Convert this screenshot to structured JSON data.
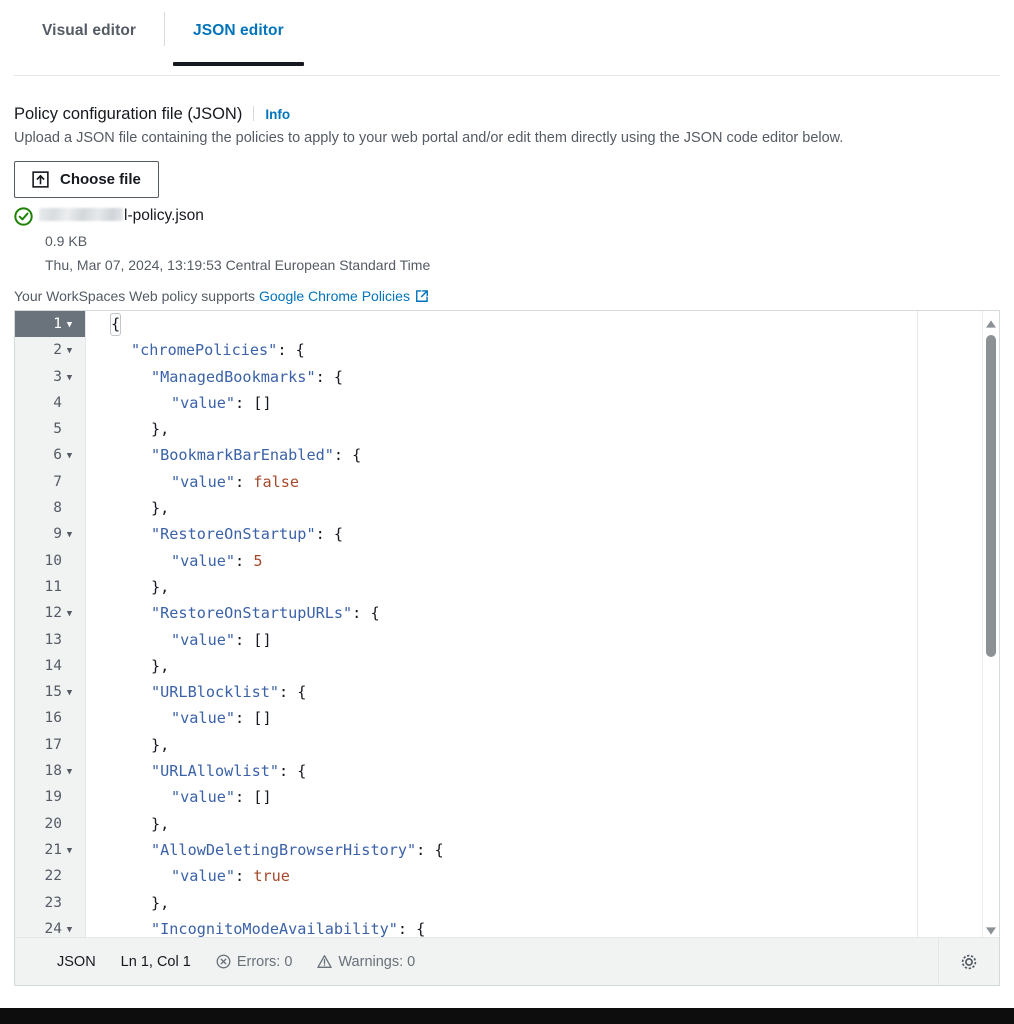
{
  "tabs": [
    {
      "label": "Visual editor",
      "active": false
    },
    {
      "label": "JSON editor",
      "active": true
    }
  ],
  "field": {
    "title": "Policy configuration file (JSON)",
    "info_label": "Info",
    "description": "Upload a JSON file containing the policies to apply to your web portal and/or edit them directly using the JSON code editor below.",
    "choose_file_label": "Choose file",
    "upload_icon": "upload-icon"
  },
  "uploaded_file": {
    "status_icon": "success-check-icon",
    "name_redacted": true,
    "name_suffix": "l-policy.json",
    "size": "0.9 KB",
    "timestamp": "Thu, Mar 07, 2024, 13:19:53 Central European Standard Time"
  },
  "supports": {
    "prefix": "Your WorkSpaces Web policy supports",
    "link_label": "Google Chrome Policies",
    "external_icon": "external-link-icon"
  },
  "editor": {
    "active_line": 1,
    "lines": [
      {
        "n": 1,
        "fold": true,
        "indent": 0,
        "tokens": [
          {
            "t": "{",
            "c": "punct",
            "match": true
          }
        ]
      },
      {
        "n": 2,
        "fold": true,
        "indent": 1,
        "tokens": [
          {
            "t": "\"chromePolicies\"",
            "c": "key"
          },
          {
            "t": ": {",
            "c": "punct"
          }
        ]
      },
      {
        "n": 3,
        "fold": true,
        "indent": 2,
        "tokens": [
          {
            "t": "\"ManagedBookmarks\"",
            "c": "key"
          },
          {
            "t": ": {",
            "c": "punct"
          }
        ]
      },
      {
        "n": 4,
        "fold": false,
        "indent": 3,
        "tokens": [
          {
            "t": "\"value\"",
            "c": "key"
          },
          {
            "t": ": []",
            "c": "punct"
          }
        ]
      },
      {
        "n": 5,
        "fold": false,
        "indent": 2,
        "tokens": [
          {
            "t": "},",
            "c": "punct"
          }
        ]
      },
      {
        "n": 6,
        "fold": true,
        "indent": 2,
        "tokens": [
          {
            "t": "\"BookmarkBarEnabled\"",
            "c": "key"
          },
          {
            "t": ": {",
            "c": "punct"
          }
        ]
      },
      {
        "n": 7,
        "fold": false,
        "indent": 3,
        "tokens": [
          {
            "t": "\"value\"",
            "c": "key"
          },
          {
            "t": ": ",
            "c": "punct"
          },
          {
            "t": "false",
            "c": "lit"
          }
        ]
      },
      {
        "n": 8,
        "fold": false,
        "indent": 2,
        "tokens": [
          {
            "t": "},",
            "c": "punct"
          }
        ]
      },
      {
        "n": 9,
        "fold": true,
        "indent": 2,
        "tokens": [
          {
            "t": "\"RestoreOnStartup\"",
            "c": "key"
          },
          {
            "t": ": {",
            "c": "punct"
          }
        ]
      },
      {
        "n": 10,
        "fold": false,
        "indent": 3,
        "tokens": [
          {
            "t": "\"value\"",
            "c": "key"
          },
          {
            "t": ": ",
            "c": "punct"
          },
          {
            "t": "5",
            "c": "num"
          }
        ]
      },
      {
        "n": 11,
        "fold": false,
        "indent": 2,
        "tokens": [
          {
            "t": "},",
            "c": "punct"
          }
        ]
      },
      {
        "n": 12,
        "fold": true,
        "indent": 2,
        "tokens": [
          {
            "t": "\"RestoreOnStartupURLs\"",
            "c": "key"
          },
          {
            "t": ": {",
            "c": "punct"
          }
        ]
      },
      {
        "n": 13,
        "fold": false,
        "indent": 3,
        "tokens": [
          {
            "t": "\"value\"",
            "c": "key"
          },
          {
            "t": ": []",
            "c": "punct"
          }
        ]
      },
      {
        "n": 14,
        "fold": false,
        "indent": 2,
        "tokens": [
          {
            "t": "},",
            "c": "punct"
          }
        ]
      },
      {
        "n": 15,
        "fold": true,
        "indent": 2,
        "tokens": [
          {
            "t": "\"URLBlocklist\"",
            "c": "key"
          },
          {
            "t": ": {",
            "c": "punct"
          }
        ]
      },
      {
        "n": 16,
        "fold": false,
        "indent": 3,
        "tokens": [
          {
            "t": "\"value\"",
            "c": "key"
          },
          {
            "t": ": []",
            "c": "punct"
          }
        ]
      },
      {
        "n": 17,
        "fold": false,
        "indent": 2,
        "tokens": [
          {
            "t": "},",
            "c": "punct"
          }
        ]
      },
      {
        "n": 18,
        "fold": true,
        "indent": 2,
        "tokens": [
          {
            "t": "\"URLAllowlist\"",
            "c": "key"
          },
          {
            "t": ": {",
            "c": "punct"
          }
        ]
      },
      {
        "n": 19,
        "fold": false,
        "indent": 3,
        "tokens": [
          {
            "t": "\"value\"",
            "c": "key"
          },
          {
            "t": ": []",
            "c": "punct"
          }
        ]
      },
      {
        "n": 20,
        "fold": false,
        "indent": 2,
        "tokens": [
          {
            "t": "},",
            "c": "punct"
          }
        ]
      },
      {
        "n": 21,
        "fold": true,
        "indent": 2,
        "tokens": [
          {
            "t": "\"AllowDeletingBrowserHistory\"",
            "c": "key"
          },
          {
            "t": ": {",
            "c": "punct"
          }
        ]
      },
      {
        "n": 22,
        "fold": false,
        "indent": 3,
        "tokens": [
          {
            "t": "\"value\"",
            "c": "key"
          },
          {
            "t": ": ",
            "c": "punct"
          },
          {
            "t": "true",
            "c": "lit"
          }
        ]
      },
      {
        "n": 23,
        "fold": false,
        "indent": 2,
        "tokens": [
          {
            "t": "},",
            "c": "punct"
          }
        ]
      },
      {
        "n": 24,
        "fold": true,
        "indent": 2,
        "tokens": [
          {
            "t": "\"IncognitoModeAvailability\"",
            "c": "key"
          },
          {
            "t": ": {",
            "c": "punct"
          }
        ]
      }
    ]
  },
  "statusbar": {
    "language": "JSON",
    "cursor": "Ln 1, Col 1",
    "errors_label": "Errors: 0",
    "warnings_label": "Warnings: 0",
    "errors_icon": "error-circle-icon",
    "warnings_icon": "warning-triangle-icon",
    "settings_icon": "gear-icon"
  },
  "colors": {
    "accent_link": "#0073bb",
    "tab_active_underline": "#16191f",
    "success_green": "#1d8102",
    "json_key": "#3b62a8",
    "json_literal": "#a8492c",
    "gutter_bg": "#f1f3f3",
    "active_gutter_bg": "#6a737b"
  }
}
